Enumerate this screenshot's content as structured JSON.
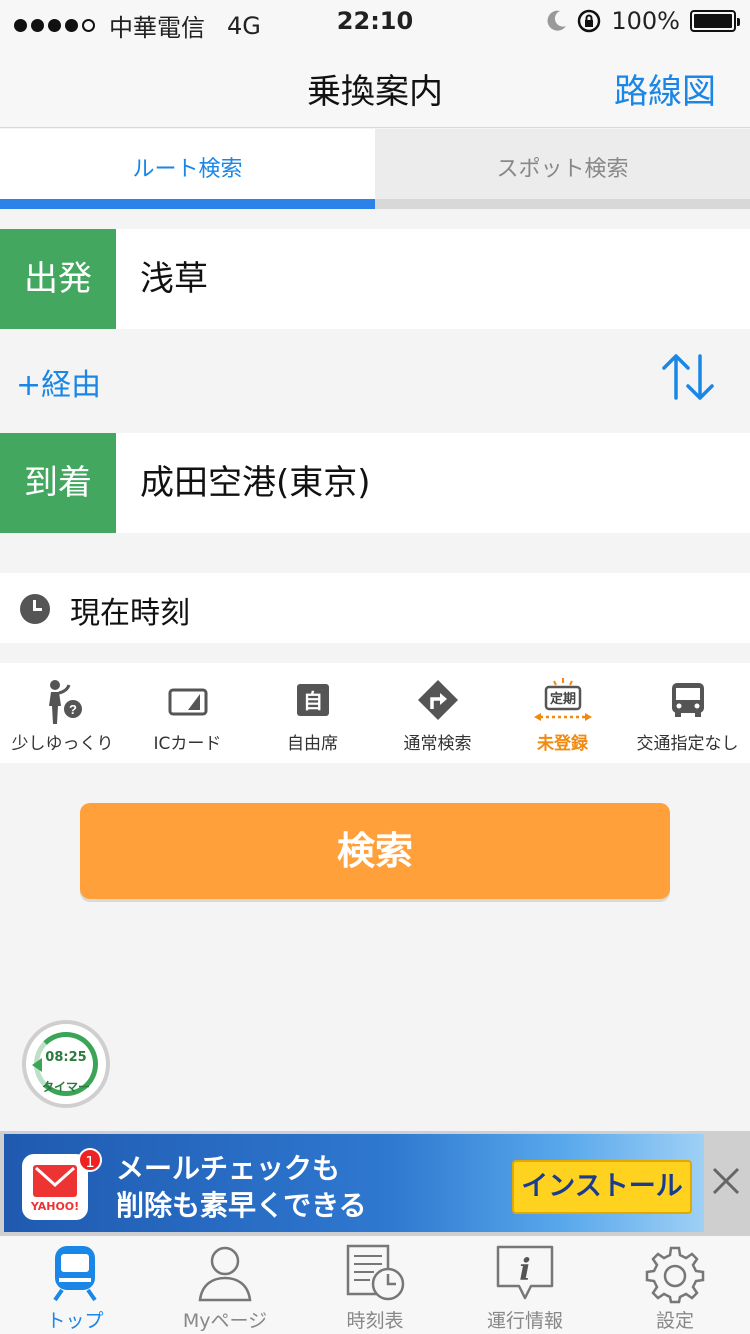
{
  "status_bar": {
    "carrier": "中華電信",
    "network": "4G",
    "time": "22:10",
    "battery": "100%"
  },
  "nav": {
    "title": "乗換案内",
    "right_button": "路線図"
  },
  "tabs": [
    {
      "label": "ルート検索",
      "active": true
    },
    {
      "label": "スポット検索",
      "active": false
    }
  ],
  "departure": {
    "label": "出発",
    "value": "浅草"
  },
  "via": {
    "add_label": "+経由",
    "swap_icon": "swap-arrows-icon"
  },
  "arrival": {
    "label": "到着",
    "value": "成田空港(東京)"
  },
  "time_setting": {
    "icon": "clock-icon",
    "label": "現在時刻"
  },
  "options": [
    {
      "icon": "walking-person-icon",
      "label": "少しゆっくり"
    },
    {
      "icon": "ic-card-icon",
      "label": "ICカード"
    },
    {
      "icon": "reserved-seat-icon",
      "label": "自由席",
      "icon_text": "自"
    },
    {
      "icon": "route-arrow-icon",
      "label": "通常検索"
    },
    {
      "icon": "commuter-pass-icon",
      "label": "未登録",
      "icon_text": "定期",
      "highlight": true
    },
    {
      "icon": "bus-icon",
      "label": "交通指定なし"
    }
  ],
  "search_button": "検索",
  "timer": {
    "time": "08:25",
    "label": "タイマー"
  },
  "ad": {
    "badge": "1",
    "logo_text": "YAHOO!",
    "line1": "メールチェックも",
    "line2": "削除も素早くできる",
    "install": "インストール"
  },
  "tab_bar": [
    {
      "icon": "train-icon",
      "label": "トップ",
      "active": true
    },
    {
      "icon": "person-icon",
      "label": "Myページ",
      "active": false
    },
    {
      "icon": "timetable-icon",
      "label": "時刻表",
      "active": false
    },
    {
      "icon": "info-icon",
      "label": "運行情報",
      "active": false
    },
    {
      "icon": "gear-icon",
      "label": "設定",
      "active": false
    }
  ],
  "colors": {
    "accent_blue": "#1a86e6",
    "label_green": "#44a760",
    "search_orange": "#ffa03a",
    "highlight_orange": "#f08a10"
  }
}
